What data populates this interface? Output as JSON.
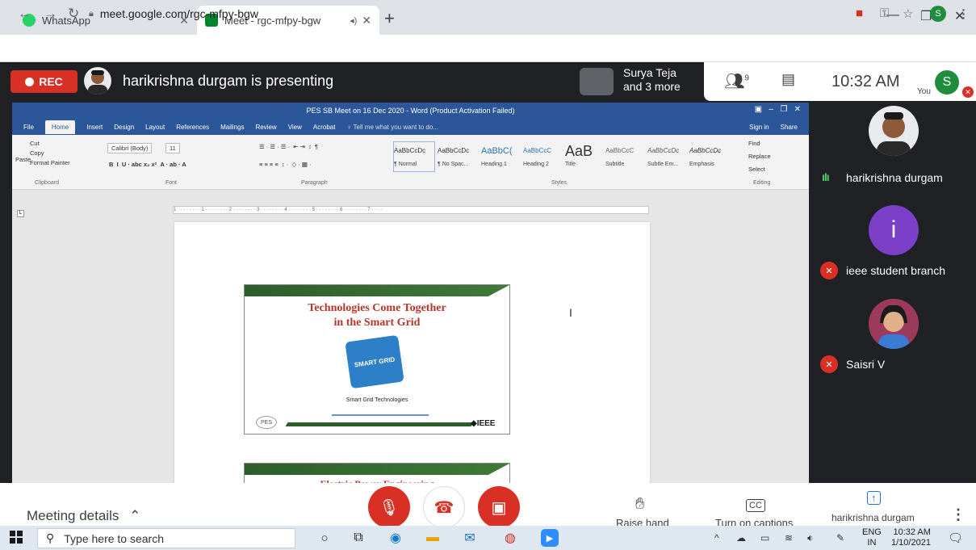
{
  "browser": {
    "tabs": [
      {
        "title": "WhatsApp",
        "favicon_color": "#25d366"
      },
      {
        "title": "Meet - rgc-mfpy-bgw",
        "favicon_color": "#00832d",
        "audio_icon": "◂)"
      }
    ],
    "close_glyph": "✕",
    "new_tab_glyph": "+",
    "url": "meet.google.com/rgc-mfpy-bgw",
    "profile_initial": "S"
  },
  "meet": {
    "rec_label": "REC",
    "presenting_text": "harikrishna durgam is presenting",
    "participants_line1": "Surya Teja",
    "participants_line2": "and 3 more",
    "people_badge": "9",
    "clock": "10:32 AM",
    "you_label": "You",
    "self_initial": "S",
    "meeting_details": "Meeting details",
    "raise_hand": "Raise hand",
    "captions": "Turn on captions",
    "presenter_tile_name": "harikrishna durgam",
    "participants": [
      {
        "name": "harikrishna durgam",
        "avatar_color": "#3c4043",
        "speaking": true,
        "muted": false,
        "initial": ""
      },
      {
        "name": "ieee student branch",
        "avatar_color": "#7b3fc9",
        "speaking": false,
        "muted": true,
        "initial": "i"
      },
      {
        "name": "Saisri V",
        "avatar_color": "#a64a6a",
        "speaking": false,
        "muted": true,
        "initial": ""
      }
    ]
  },
  "word": {
    "title": "PES SB Meet on 16 Dec 2020 - Word (Product Activation Failed)",
    "tabs": [
      "File",
      "Home",
      "Insert",
      "Design",
      "Layout",
      "References",
      "Mailings",
      "Review",
      "View",
      "Acrobat",
      "♀ Tell me what you want to do..."
    ],
    "signin": "Sign in",
    "share": "Share",
    "clipboard": {
      "cut": "Cut",
      "copy": "Copy",
      "paste": "Paste",
      "format_painter": "Format Painter",
      "group": "Clipboard"
    },
    "font": {
      "name": "Calibri (Body)",
      "size": "11",
      "group": "Font"
    },
    "paragraph_group": "Paragraph",
    "styles_group": "Styles",
    "editing": {
      "find": "Find",
      "replace": "Replace",
      "select": "Select",
      "group": "Editing"
    },
    "styles": [
      {
        "preview": "AaBbCcDc",
        "label": "¶ Normal"
      },
      {
        "preview": "AaBbCcDc",
        "label": "¶ No Spac..."
      },
      {
        "preview": "AaBbC(",
        "label": "Heading 1"
      },
      {
        "preview": "AaBbCcC",
        "label": "Heading 2"
      },
      {
        "preview": "AaB",
        "label": "Title"
      },
      {
        "preview": "AaBbCcC",
        "label": "Subtitle"
      },
      {
        "preview": "AaBbCcDc",
        "label": "Subtle Em..."
      },
      {
        "preview": "AaBbCcDc",
        "label": "Emphasis"
      }
    ],
    "ruler_text": "1 · · · · · · · · 1 · · · · · · · · 2 · · · · · · · · 3 · · · · · · · · 4 · · · · · · · · 5 · · · · · · · · 6 · · · · · · · · 7 · · · ·",
    "slide1": {
      "title_line1": "Technologies Come Together",
      "title_line2": "in the Smart Grid",
      "puzzle_text": "SMART GRID",
      "caption": "Smart Grid Technologies",
      "ieee": "◆IEEE",
      "logo": "PES"
    },
    "slide2": {
      "title": "Electric Power Engineering"
    }
  },
  "taskbar": {
    "search_placeholder": "Type here to search",
    "lang_line1": "ENG",
    "lang_line2": "IN",
    "time": "10:32 AM",
    "date": "1/10/2021"
  }
}
